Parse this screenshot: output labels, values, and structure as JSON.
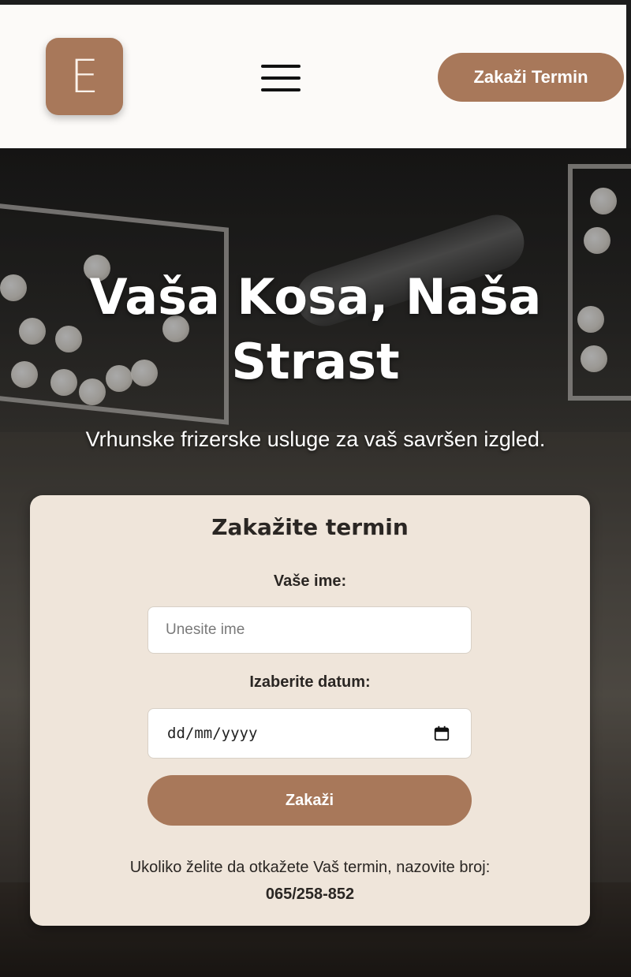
{
  "header": {
    "logo_letter": "E",
    "menu_icon": "hamburger-menu-icon",
    "cta_label": "Zakaži Termin"
  },
  "hero": {
    "title": "Vaša Kosa, Naša Strast",
    "subtitle": "Vrhunske frizerske usluge za vaš savršen izgled."
  },
  "booking": {
    "title": "Zakažite termin",
    "name_label": "Vaše ime:",
    "name_placeholder": "Unesite ime",
    "date_label": "Izaberite datum:",
    "date_placeholder": "dd/mm/yyyy",
    "calendar_icon": "calendar-icon",
    "submit_label": "Zakaži",
    "cancel_note": "Ukoliko želite da otkažete Vaš termin, nazovite broj:",
    "phone": "065/258-852"
  },
  "colors": {
    "accent": "#a8785a",
    "card_background": "#efe5da",
    "header_background": "#fcfaf8"
  }
}
